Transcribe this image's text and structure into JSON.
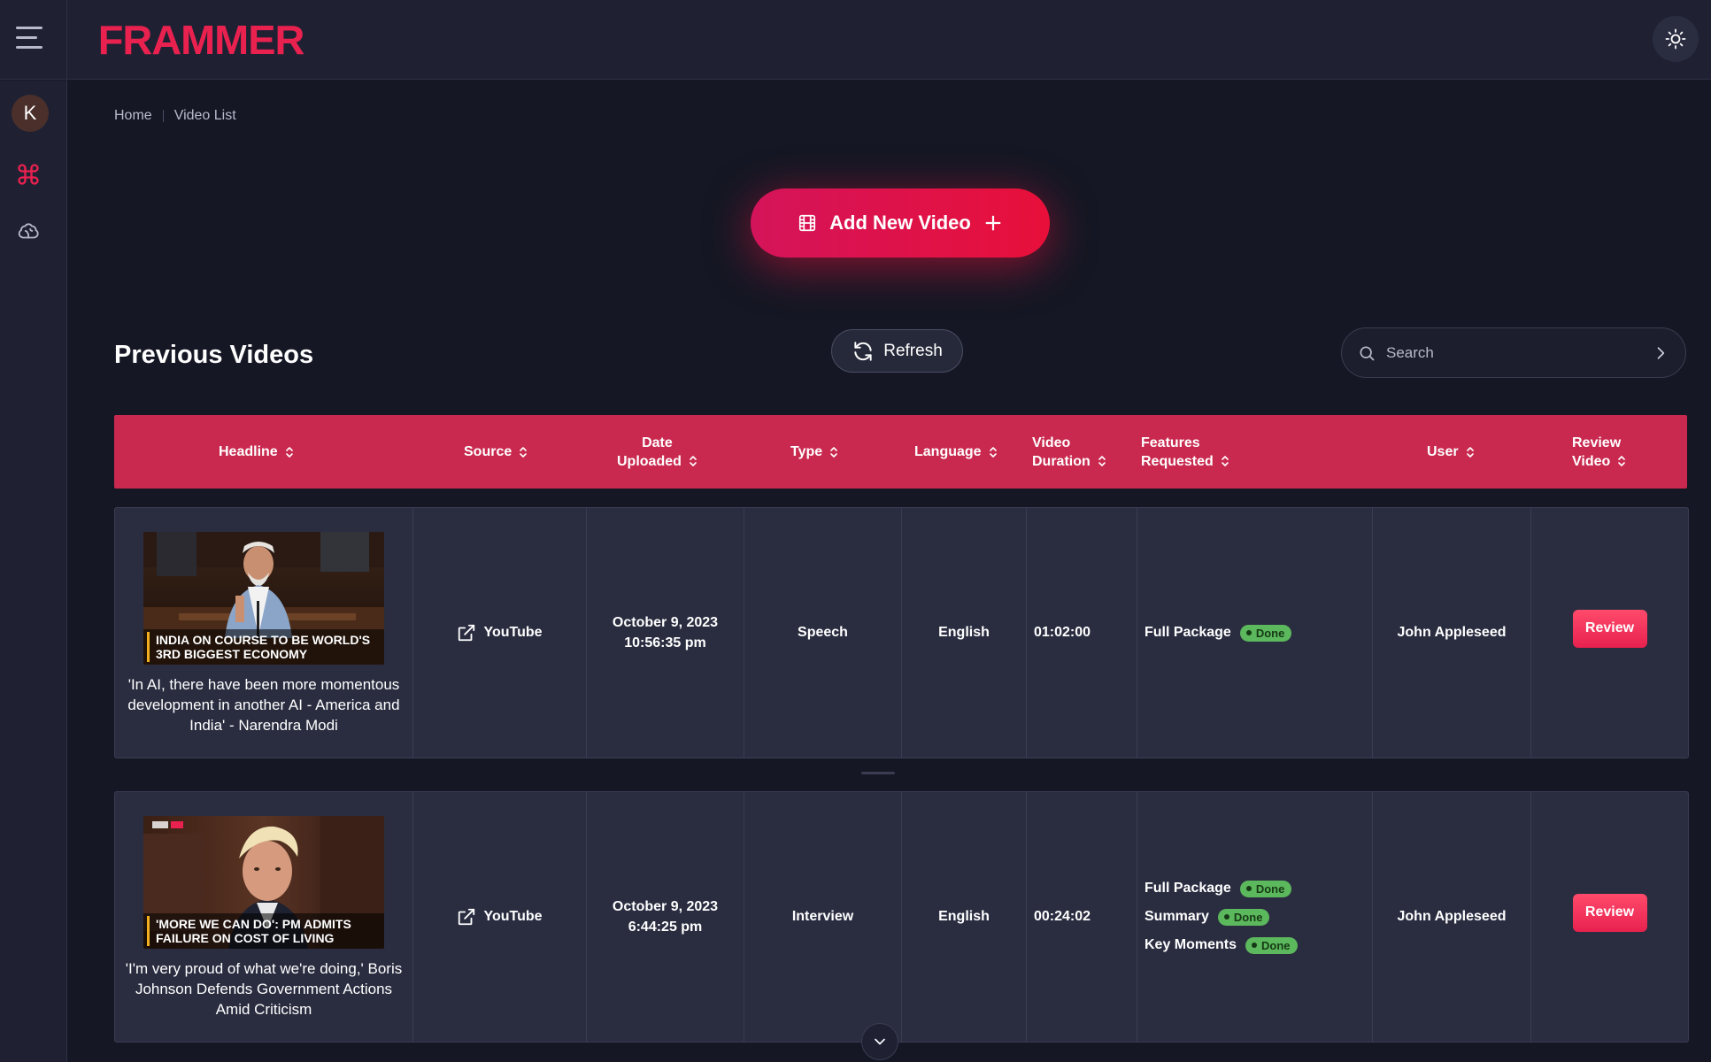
{
  "app": {
    "logo": "FRAMMER",
    "user_initial": "K"
  },
  "breadcrumb": {
    "home": "Home",
    "current": "Video List"
  },
  "actions": {
    "add_video_label": "Add New Video",
    "refresh_label": "Refresh"
  },
  "section": {
    "title": "Previous Videos"
  },
  "search": {
    "placeholder": "Search"
  },
  "table": {
    "headers": {
      "headline": "Headline",
      "source": "Source",
      "date_line1": "Date",
      "date_line2": "Uploaded",
      "type": "Type",
      "language": "Language",
      "duration_line1": "Video",
      "duration_line2": "Duration",
      "features_line1": "Features",
      "features_line2": "Requested",
      "user": "User",
      "review_line1": "Review",
      "review_line2": "Video"
    },
    "rows": [
      {
        "thumb_caption_line1": "INDIA ON COURSE TO BE WORLD'S",
        "thumb_caption_line2": "3RD BIGGEST ECONOMY",
        "headline": "'In AI, there have been more momentous development in another AI - America and India' - Narendra Modi",
        "source": "YouTube",
        "date_line1": "October 9, 2023",
        "date_line2": "10:56:35 pm",
        "type": "Speech",
        "language": "English",
        "duration": "01:02:00",
        "features": [
          {
            "name": "Full Package",
            "status": "Done"
          }
        ],
        "user": "John Appleseed",
        "review_label": "Review"
      },
      {
        "thumb_caption_line1": "'MORE WE CAN DO': PM ADMITS",
        "thumb_caption_line2": "FAILURE ON COST OF LIVING",
        "headline": "'I'm very proud of what we're doing,' Boris Johnson Defends Government Actions Amid Criticism",
        "source": "YouTube",
        "date_line1": "October 9, 2023",
        "date_line2": "6:44:25 pm",
        "type": "Interview",
        "language": "English",
        "duration": "00:24:02",
        "features": [
          {
            "name": "Full Package",
            "status": "Done"
          },
          {
            "name": "Summary",
            "status": "Done"
          },
          {
            "name": "Key Moments",
            "status": "Done"
          }
        ],
        "user": "John Appleseed",
        "review_label": "Review"
      }
    ]
  },
  "colors": {
    "brand": "#e8214f",
    "header_bg": "#c9294f",
    "badge_done": "#5cb85c"
  },
  "icons": {
    "menu": "hamburger-icon",
    "theme": "sun-icon",
    "command": "command-icon",
    "brain": "brain-icon",
    "film": "film-icon",
    "plus": "plus-icon",
    "refresh": "refresh-icon",
    "search": "search-icon",
    "chevron_right": "chevron-right-icon",
    "sort": "sort-icon",
    "external": "external-link-icon",
    "chevron_down": "chevron-down-icon"
  }
}
